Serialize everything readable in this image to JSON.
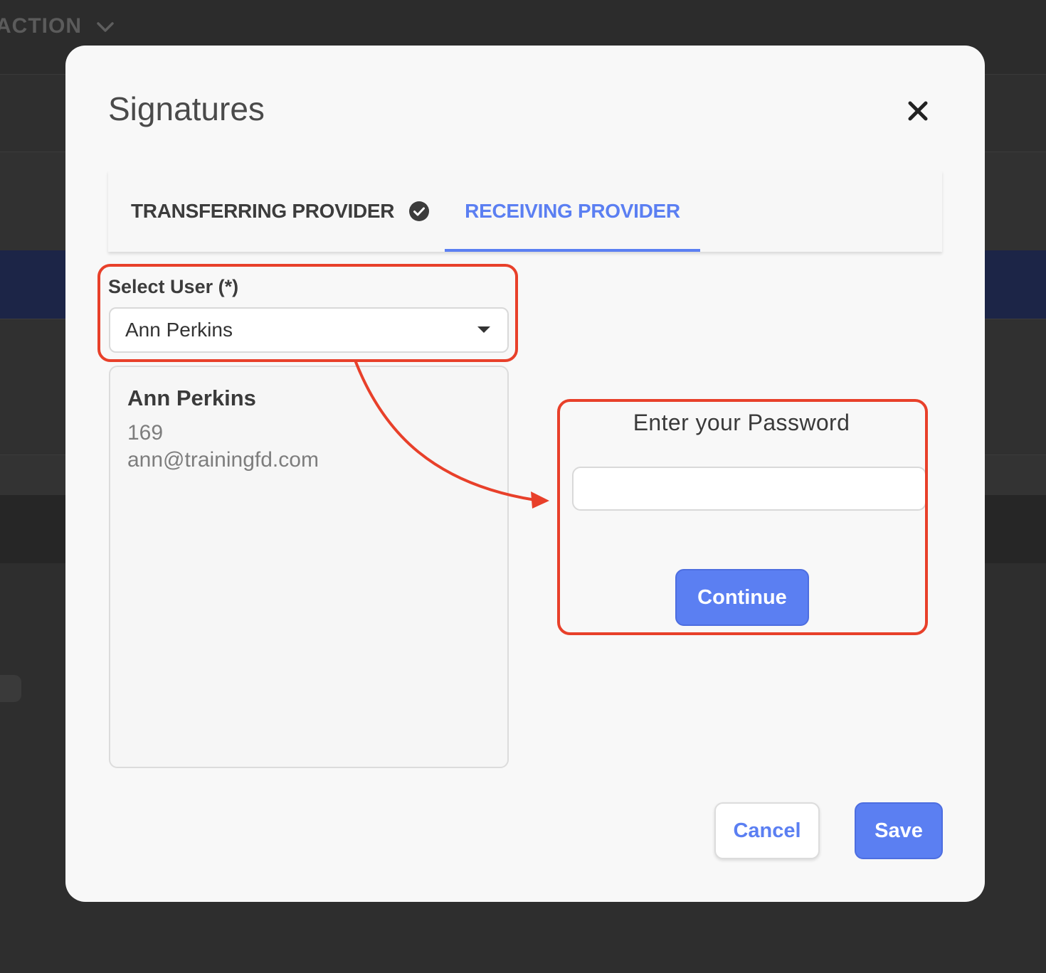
{
  "background": {
    "action_label": "ACTION",
    "icons": {
      "dropdown": "chevron-down-icon"
    }
  },
  "modal": {
    "title": "Signatures",
    "icons": {
      "close": "close-icon"
    },
    "tabs": [
      {
        "label": "TRANSFERRING PROVIDER",
        "completed": true,
        "icon": "check-circle-icon",
        "active": false
      },
      {
        "label": "RECEIVING PROVIDER",
        "completed": false,
        "active": true
      }
    ],
    "select_user": {
      "label": "Select User (*)",
      "value": "Ann Perkins",
      "icon": "caret-down-icon"
    },
    "user_card": {
      "name": "Ann Perkins",
      "id": "169",
      "email": "ann@trainingfd.com"
    },
    "password": {
      "title": "Enter your Password",
      "value": "",
      "placeholder": "",
      "continue_label": "Continue"
    },
    "footer": {
      "cancel_label": "Cancel",
      "save_label": "Save"
    }
  },
  "colors": {
    "accent": "#5b7ff2",
    "annotation": "#e8402a",
    "overlay": "#2e2e2e",
    "modal_bg": "#f8f8f8"
  }
}
